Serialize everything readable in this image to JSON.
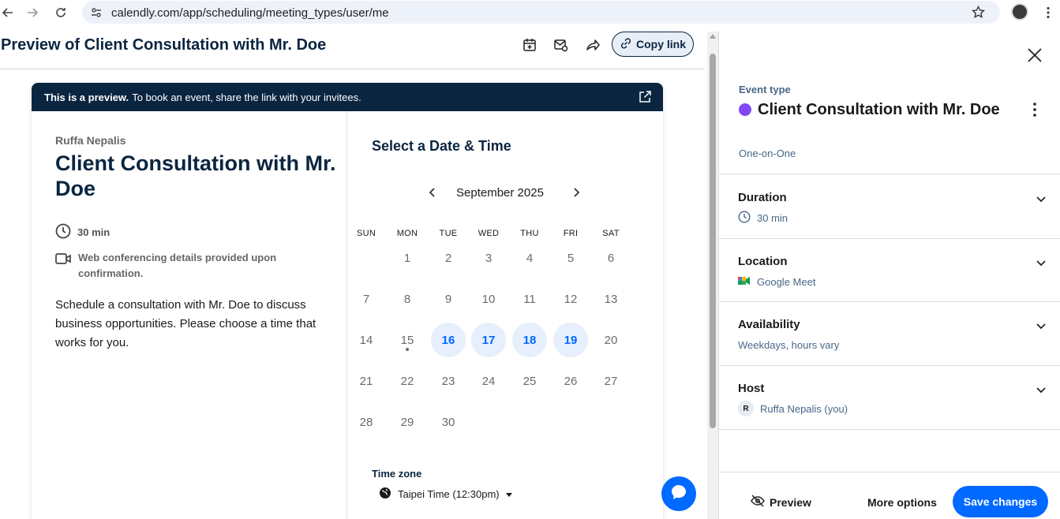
{
  "browser": {
    "url": "calendly.com/app/scheduling/meeting_types/user/me"
  },
  "preview_header": {
    "title": "Preview of Client Consultation with Mr. Doe",
    "copy_link_label": "Copy link"
  },
  "banner": {
    "bold": "This is a preview.",
    "text": "To book an event, share the link with your invitees."
  },
  "event": {
    "organizer": "Ruffa Nepalis",
    "name": "Client Consultation with Mr. Doe",
    "duration": "30 min",
    "conferencing": "Web conferencing details provided upon confirmation.",
    "description": "Schedule a consultation with Mr. Doe to discuss business opportunities. Please choose a time that works for you."
  },
  "calendar": {
    "heading": "Select a Date & Time",
    "month": "September 2025",
    "weekdays": [
      "SUN",
      "MON",
      "TUE",
      "WED",
      "THU",
      "FRI",
      "SAT"
    ],
    "available_days": [
      16,
      17,
      18,
      19
    ],
    "today": 15,
    "timezone_label": "Time zone",
    "timezone_value": "Taipei Time (12:30pm)"
  },
  "panel": {
    "event_type_label": "Event type",
    "event_name": "Client Consultation with Mr. Doe",
    "event_kind": "One-on-One",
    "duration_title": "Duration",
    "duration_value": "30 min",
    "location_title": "Location",
    "location_value": "Google Meet",
    "availability_title": "Availability",
    "availability_value": "Weekdays, hours vary",
    "host_title": "Host",
    "host_initial": "R",
    "host_value": "Ruffa Nepalis (you)",
    "preview_label": "Preview",
    "more_options_label": "More options",
    "save_label": "Save changes"
  },
  "colors": {
    "navy": "#0a2540",
    "accent": "#0069ff",
    "event_dot": "#8247f5"
  }
}
